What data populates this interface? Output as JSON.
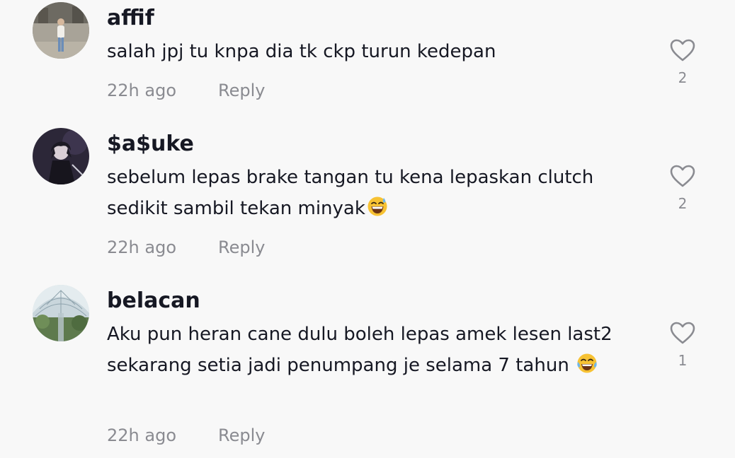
{
  "comments": [
    {
      "username": "affif",
      "text": "salah jpj tu knpa dia tk ckp turun kedepan",
      "emoji": "",
      "time": "22h ago",
      "reply": "Reply",
      "likes": "2",
      "avatar_icon": "person-photo-avatar"
    },
    {
      "username": "$a$uke",
      "text": "sebelum lepas brake tangan tu kena lepaskan clutch sedikit sambil tekan minyak",
      "emoji": "grinning-sweat-emoji",
      "time": "22h ago",
      "reply": "Reply",
      "likes": "2",
      "avatar_icon": "anime-character-avatar"
    },
    {
      "username": "belacan",
      "text": "Aku pun heran cane dulu boleh lepas amek lesen last2 sekarang setia jadi penumpang je selama 7 tahun",
      "emoji": "tears-of-joy-emoji",
      "time": "22h ago",
      "reply": "Reply",
      "likes": "1",
      "avatar_icon": "glass-dome-avatar"
    }
  ],
  "colors": {
    "background": "#f8f8f8",
    "text": "#161823",
    "secondary": "#8a8b91",
    "heart_outline": "#8a8b91"
  }
}
